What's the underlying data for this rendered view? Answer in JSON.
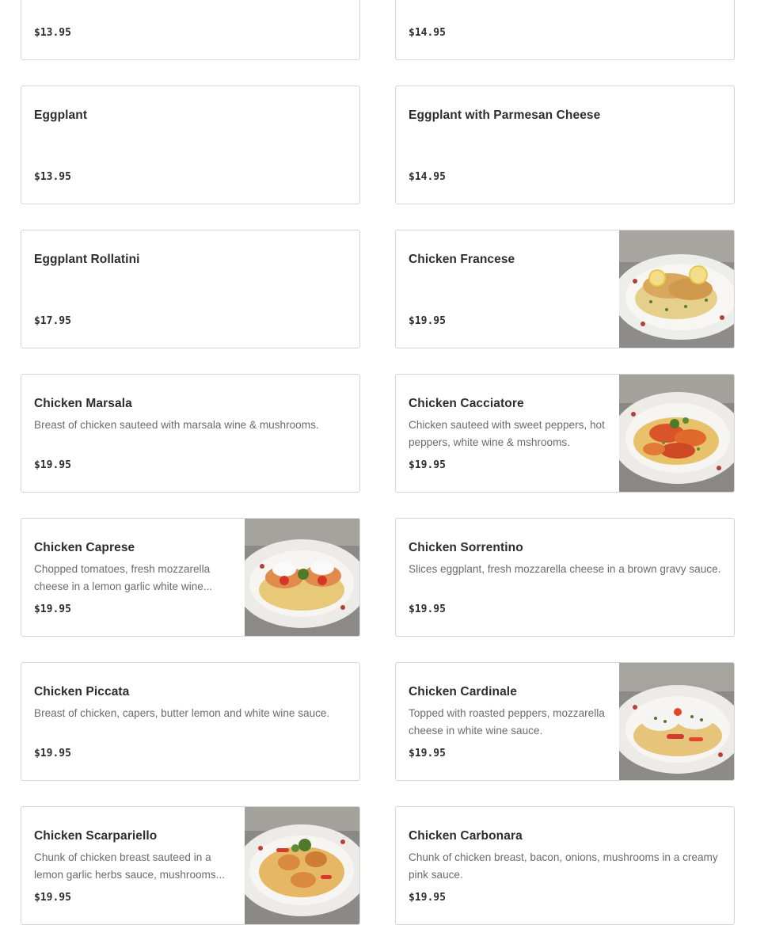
{
  "menu_items": [
    {
      "name": "",
      "description": "",
      "price": "$13.95"
    },
    {
      "name": "",
      "description": "",
      "price": "$14.95"
    },
    {
      "name": "Eggplant",
      "description": "",
      "price": "$13.95"
    },
    {
      "name": "Eggplant with Parmesan Cheese",
      "description": "",
      "price": "$14.95"
    },
    {
      "name": "Eggplant Rollatini",
      "description": "",
      "price": "$17.95"
    },
    {
      "name": "Chicken Francese",
      "description": "",
      "price": "$19.95",
      "image": "chicken-francese-photo"
    },
    {
      "name": "Chicken Marsala",
      "description": "Breast of chicken sauteed with marsala wine & mushrooms.",
      "price": "$19.95"
    },
    {
      "name": "Chicken Cacciatore",
      "description": "Chicken sauteed with sweet peppers, hot peppers, white wine & mshrooms.",
      "price": "$19.95",
      "image": "chicken-cacciatore-photo"
    },
    {
      "name": "Chicken Caprese",
      "description": "Chopped tomatoes, fresh mozzarella cheese in a lemon garlic white wine...",
      "price": "$19.95",
      "image": "chicken-caprese-photo"
    },
    {
      "name": "Chicken Sorrentino",
      "description": "Slices eggplant, fresh mozzarella cheese in a brown gravy sauce.",
      "price": "$19.95"
    },
    {
      "name": "Chicken Piccata",
      "description": "Breast of chicken, capers, butter lemon and white wine sauce.",
      "price": "$19.95"
    },
    {
      "name": "Chicken Cardinale",
      "description": "Topped with roasted peppers, mozzarella cheese in white wine sauce.",
      "price": "$19.95",
      "image": "chicken-cardinale-photo"
    },
    {
      "name": "Chicken Scarpariello",
      "description": "Chunk of chicken breast sauteed in a lemon garlic herbs sauce, mushrooms...",
      "price": "$19.95",
      "image": "chicken-scarpariello-photo"
    },
    {
      "name": "Chicken Carbonara",
      "description": "Chunk of chicken breast, bacon, onions, mushrooms in a creamy pink sauce.",
      "price": "$19.95"
    }
  ]
}
